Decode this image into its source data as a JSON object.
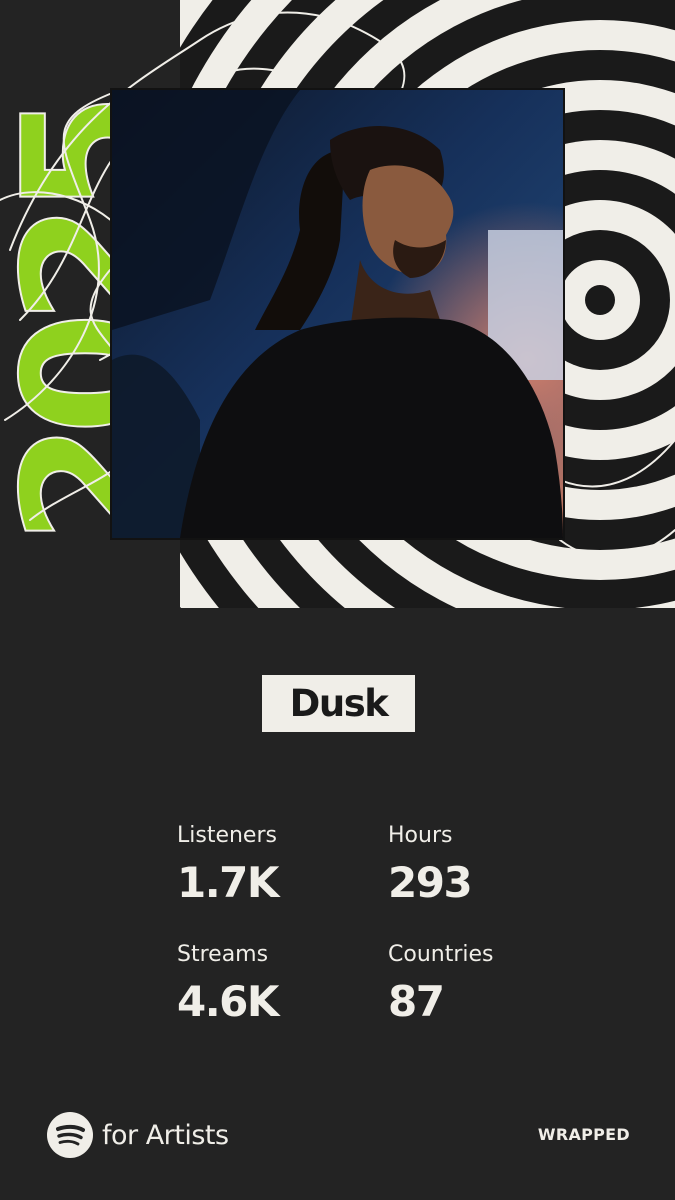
{
  "art": {
    "year": "2025",
    "accent_color": "#8fd11e",
    "photo_alt_icon": "artist-portrait"
  },
  "artist": {
    "name": "Dusk"
  },
  "stats": {
    "listeners_label": "Listeners",
    "listeners_value": "1.7K",
    "hours_label": "Hours",
    "hours_value": "293",
    "streams_label": "Streams",
    "streams_value": "4.6K",
    "countries_label": "Countries",
    "countries_value": "87"
  },
  "footer": {
    "logo_icon": "spotify-logo-icon",
    "brand": "for Artists",
    "tag": "WRAPPED"
  }
}
